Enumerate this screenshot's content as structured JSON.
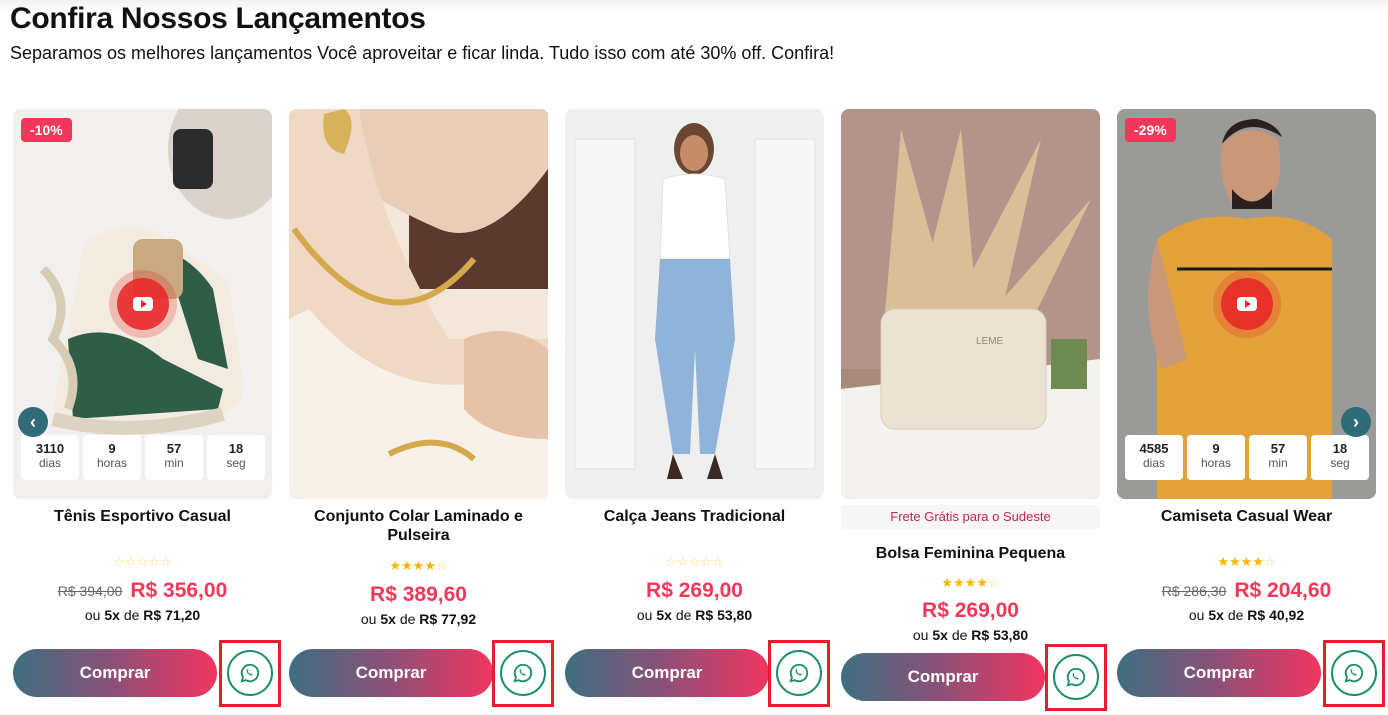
{
  "section": {
    "title": "Confira Nossos Lançamentos",
    "subtitle": "Separamos os melhores lançamentos Você aproveitar e ficar linda. Tudo isso com até 30% off. Confira!"
  },
  "nav": {
    "prev_icon": "chevron-left-icon",
    "next_icon": "chevron-right-icon",
    "prev_glyph": "‹",
    "next_glyph": "›"
  },
  "colors": {
    "accent": "#f2385a",
    "teal": "#2f6b78",
    "whatsapp": "#1a8f6e",
    "highlight": "#e0202c"
  },
  "products": [
    {
      "name": "Tênis Esportivo Casual",
      "discount": "-10%",
      "has_video": true,
      "countdown": [
        {
          "value": "3110",
          "label": "dias"
        },
        {
          "value": "9",
          "label": "horas"
        },
        {
          "value": "57",
          "label": "min"
        },
        {
          "value": "18",
          "label": "seg"
        }
      ],
      "rating": 0,
      "old_price": "R$ 394,00",
      "price": "R$ 356,00",
      "installments_prefix": "ou",
      "installments_count": "5x",
      "installments_mid": "de",
      "installments_value": "R$ 71,20",
      "buy_label": "Comprar",
      "whatsapp_icon": "whatsapp-icon"
    },
    {
      "name": "Conjunto Colar Laminado e Pulseira",
      "discount": "",
      "has_video": false,
      "rating": 4,
      "old_price": "",
      "price": "R$ 389,60",
      "installments_prefix": "ou",
      "installments_count": "5x",
      "installments_mid": "de",
      "installments_value": "R$ 77,92",
      "buy_label": "Comprar",
      "whatsapp_icon": "whatsapp-icon"
    },
    {
      "name": "Calça Jeans Tradicional",
      "discount": "",
      "has_video": false,
      "rating": 0,
      "old_price": "",
      "price": "R$ 269,00",
      "installments_prefix": "ou",
      "installments_count": "5x",
      "installments_mid": "de",
      "installments_value": "R$ 53,80",
      "buy_label": "Comprar",
      "whatsapp_icon": "whatsapp-icon"
    },
    {
      "name": "Bolsa Feminina Pequena",
      "shipping_badge": "Frete Grátis para o Sudeste",
      "discount": "",
      "has_video": false,
      "rating": 4,
      "old_price": "",
      "price": "R$ 269,00",
      "installments_prefix": "ou",
      "installments_count": "5x",
      "installments_mid": "de",
      "installments_value": "R$ 53,80",
      "buy_label": "Comprar",
      "whatsapp_icon": "whatsapp-icon"
    },
    {
      "name": "Camiseta Casual Wear",
      "discount": "-29%",
      "has_video": true,
      "countdown": [
        {
          "value": "4585",
          "label": "dias"
        },
        {
          "value": "9",
          "label": "horas"
        },
        {
          "value": "57",
          "label": "min"
        },
        {
          "value": "18",
          "label": "seg"
        }
      ],
      "rating": 4,
      "old_price": "R$ 286,30",
      "price": "R$ 204,60",
      "installments_prefix": "ou",
      "installments_count": "5x",
      "installments_mid": "de",
      "installments_value": "R$ 40,92",
      "buy_label": "Comprar",
      "whatsapp_icon": "whatsapp-icon"
    }
  ]
}
